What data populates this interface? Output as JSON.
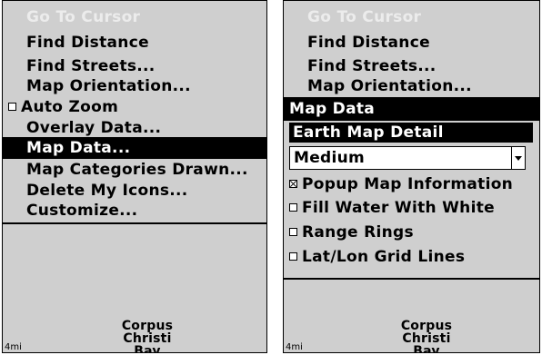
{
  "left": {
    "items": [
      {
        "label": "Go To Cursor",
        "state": "disabled"
      },
      {
        "label": "Find Distance",
        "state": "normal"
      },
      {
        "label": "Find Streets...",
        "state": "normal"
      },
      {
        "label": "Map Orientation...",
        "state": "normal"
      },
      {
        "label": "Auto Zoom",
        "state": "checkbox",
        "checked": false
      },
      {
        "label": "Overlay Data...",
        "state": "normal"
      },
      {
        "label": "Map Data...",
        "state": "selected"
      },
      {
        "label": "Map Categories Drawn...",
        "state": "normal"
      },
      {
        "label": "Delete My Icons...",
        "state": "normal"
      },
      {
        "label": "Customize...",
        "state": "normal"
      }
    ],
    "map": {
      "place_line1": "Corpus",
      "place_line2": "Christi Bay",
      "scale": "4mi"
    }
  },
  "right": {
    "items": [
      {
        "label": "Go To Cursor",
        "state": "disabled"
      },
      {
        "label": "Find Distance",
        "state": "normal"
      },
      {
        "label": "Find Streets...",
        "state": "normal"
      },
      {
        "label": "Map Orientation...",
        "state": "normal"
      }
    ],
    "submenu_title": "Map Data",
    "detail_label": "Earth Map Detail",
    "detail_value": "Medium",
    "options": [
      {
        "label": "Popup Map Information",
        "checked": true
      },
      {
        "label": "Fill Water With White",
        "checked": false
      },
      {
        "label": "Range Rings",
        "checked": false
      },
      {
        "label": "Lat/Lon Grid Lines",
        "checked": false
      }
    ],
    "map": {
      "place_line1": "Corpus",
      "place_line2": "Christi Bay",
      "scale": "4mi"
    }
  },
  "colors": {
    "background": "#cfcfcf",
    "highlight": "#000000",
    "disabled_text": "#ececec"
  }
}
